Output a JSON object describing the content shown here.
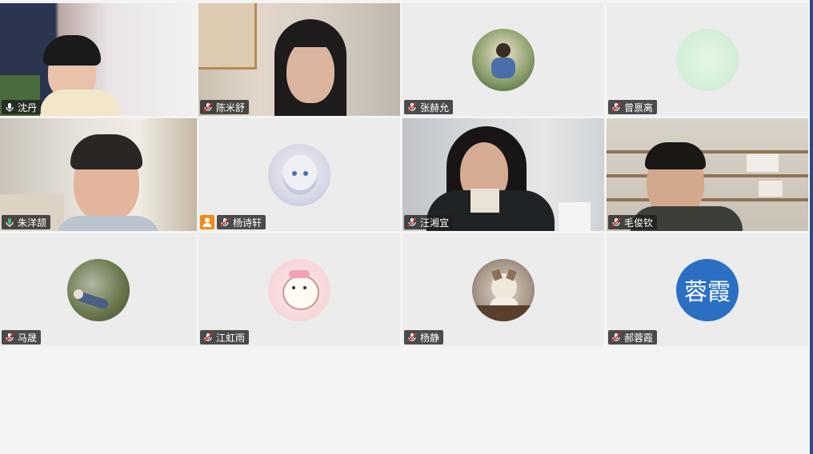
{
  "window": {
    "accent": "#2c4a86",
    "speaking_border": "#3cc17a",
    "tile_bg": "#ececec"
  },
  "participants": [
    {
      "name": "沈丹",
      "mic": "mic-on-icon",
      "type": "video"
    },
    {
      "name": "陈米舒",
      "mic": "mic-muted-icon",
      "type": "video"
    },
    {
      "name": "张赫允",
      "mic": "mic-muted-icon",
      "type": "avatar-photo"
    },
    {
      "name": "曾禀离",
      "mic": "mic-muted-icon",
      "type": "avatar-photo"
    },
    {
      "name": "朱洋颉",
      "mic": "mic-speaking-icon",
      "type": "video",
      "speaking": true
    },
    {
      "name": "杨诗轩",
      "mic": "mic-muted-icon",
      "type": "avatar-photo",
      "host_icon": "person-icon"
    },
    {
      "name": "汪湘宜",
      "mic": "mic-muted-icon",
      "type": "video"
    },
    {
      "name": "毛俊钦",
      "mic": "mic-muted-icon",
      "type": "video"
    },
    {
      "name": "马晟",
      "mic": "mic-muted-icon",
      "type": "avatar-photo"
    },
    {
      "name": "江虹雨",
      "mic": "mic-muted-icon",
      "type": "avatar-photo"
    },
    {
      "name": "杨静",
      "mic": "mic-muted-icon",
      "type": "avatar-photo"
    },
    {
      "name": "郝蓉霞",
      "mic": "mic-muted-icon",
      "type": "avatar-text",
      "avatar_text": "蓉霞",
      "avatar_color": "#2a6fc4"
    }
  ]
}
